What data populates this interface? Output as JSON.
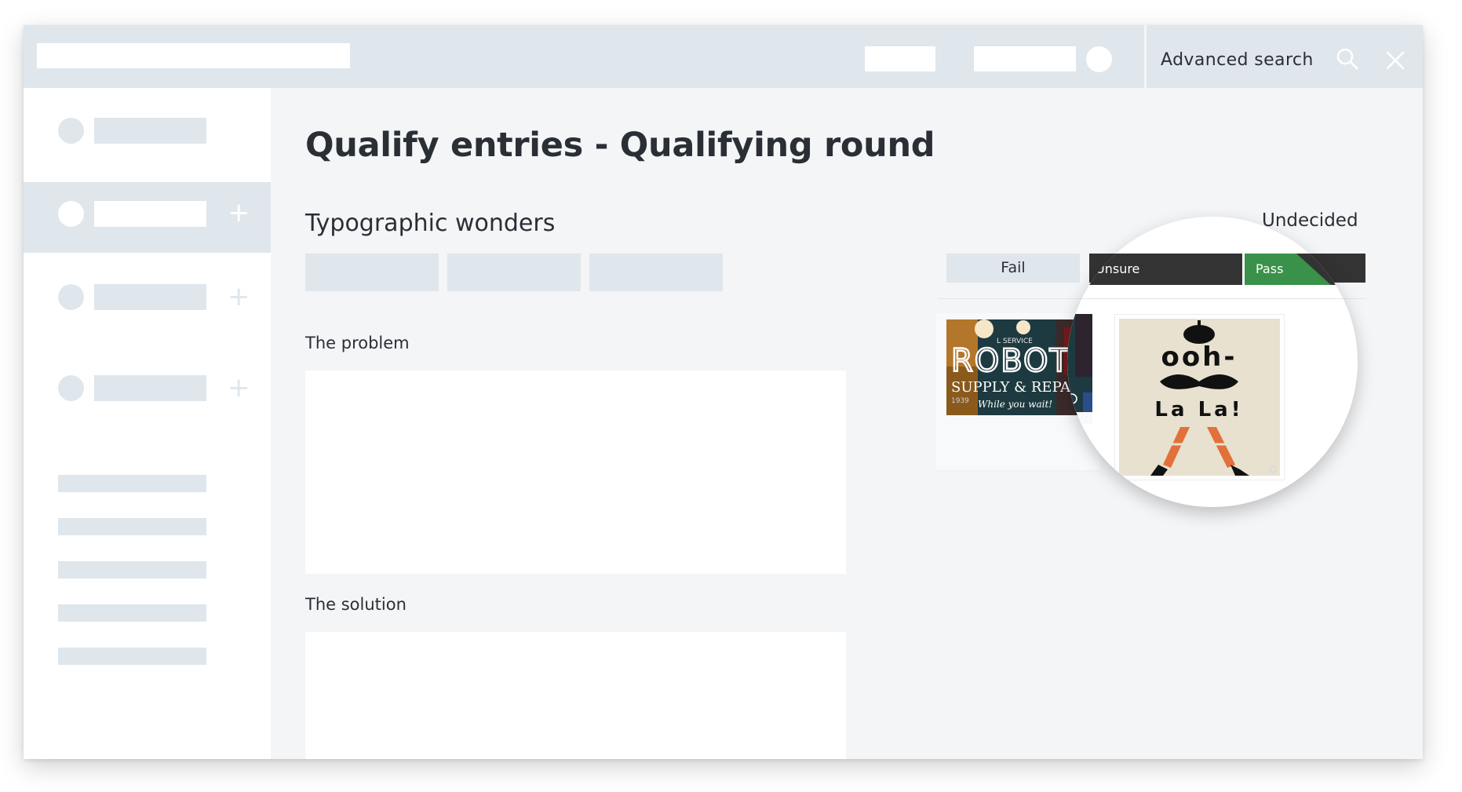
{
  "header": {
    "advanced_search_label": "Advanced search",
    "search_icon": "search-icon",
    "close_icon": "close-icon"
  },
  "page": {
    "title": "Qualify entries - Qualifying round",
    "category": "Typographic wonders"
  },
  "sections": {
    "problem_label": "The problem",
    "solution_label": "The solution"
  },
  "judging": {
    "status": "Undecided",
    "fail_label": "Fail",
    "unsure_label": "Unsure",
    "pass_label": "Pass"
  },
  "thumbnails": {
    "robot": {
      "service": "L SERVICE",
      "headline": "ROBOT",
      "sub": "SUPPLY & REPAIR",
      "script": "While you wait!",
      "year": "1939"
    },
    "oohlala": {
      "line1": "ooh-",
      "line2": "La La!"
    }
  },
  "colors": {
    "placeholder": "#dfe6ec",
    "page_bg": "#f4f5f7",
    "text": "#2a2f36",
    "dark_bar": "#333333",
    "pass_green": "#3a9149",
    "poster_bg": "#e8e1d0",
    "poster_orange": "#e2703a"
  }
}
